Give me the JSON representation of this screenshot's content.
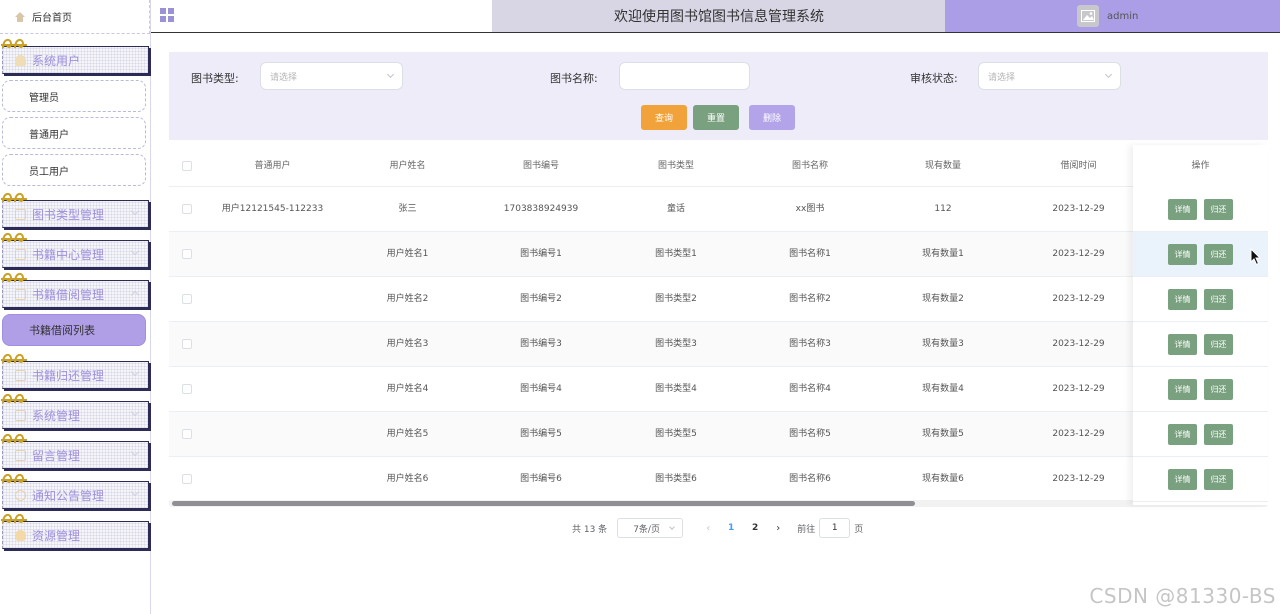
{
  "sidebar": {
    "home_label": "后台首页",
    "menus": [
      {
        "label": "系统用户",
        "icon": "user-icon"
      },
      {
        "label": "图书类型管理",
        "icon": "document-icon"
      },
      {
        "label": "书籍中心管理",
        "icon": "document-icon"
      },
      {
        "label": "书籍借阅管理",
        "icon": "document-icon"
      },
      {
        "label": "书籍归还管理",
        "icon": "document-icon"
      },
      {
        "label": "系统管理",
        "icon": "settings-icon"
      },
      {
        "label": "留言管理",
        "icon": "message-icon"
      },
      {
        "label": "通知公告管理",
        "icon": "info-icon"
      },
      {
        "label": "资源管理",
        "icon": "bulb-icon"
      }
    ],
    "user_subs": [
      "管理员",
      "普通用户",
      "员工用户"
    ],
    "borrow_sub_active": "书籍借阅列表"
  },
  "header": {
    "title": "欢迎使用图书馆图书信息管理系统",
    "username": "admin"
  },
  "search": {
    "type_label": "图书类型:",
    "type_placeholder": "请选择",
    "name_label": "图书名称:",
    "name_value": "",
    "status_label": "审核状态:",
    "status_placeholder": "请选择",
    "query_button": "查询",
    "reset_button": "重置",
    "delete_button": "删除"
  },
  "table": {
    "headers": [
      "普通用户",
      "用户姓名",
      "图书编号",
      "图书类型",
      "图书名称",
      "现有数量",
      "借阅时间"
    ],
    "ops_header": "操作",
    "detail_label": "详情",
    "return_label": "归还",
    "rows": [
      [
        "用户12121545-112233",
        "张三",
        "1703838924939",
        "童话",
        "xx图书",
        "112",
        "2023-12-29"
      ],
      [
        "",
        "用户姓名1",
        "图书编号1",
        "图书类型1",
        "图书名称1",
        "现有数量1",
        "2023-12-29"
      ],
      [
        "",
        "用户姓名2",
        "图书编号2",
        "图书类型2",
        "图书名称2",
        "现有数量2",
        "2023-12-29"
      ],
      [
        "",
        "用户姓名3",
        "图书编号3",
        "图书类型3",
        "图书名称3",
        "现有数量3",
        "2023-12-29"
      ],
      [
        "",
        "用户姓名4",
        "图书编号4",
        "图书类型4",
        "图书名称4",
        "现有数量4",
        "2023-12-29"
      ],
      [
        "",
        "用户姓名5",
        "图书编号5",
        "图书类型5",
        "图书名称5",
        "现有数量5",
        "2023-12-29"
      ],
      [
        "",
        "用户姓名6",
        "图书编号6",
        "图书类型6",
        "图书名称6",
        "现有数量6",
        "2023-12-29"
      ]
    ]
  },
  "pagination": {
    "total": "共 13 条",
    "page_size": "7条/页",
    "pages": [
      "1",
      "2"
    ],
    "current": "1",
    "goto_label": "前往",
    "goto_value": "1",
    "page_unit": "页"
  },
  "watermark": "CSDN @81330-BS",
  "colors": {
    "accent_purple": "#ab9ee6",
    "query_orange": "#f2a23a",
    "reset_green": "#7aa17f",
    "delete_purple": "#b3a4ea",
    "active_page_blue": "#409eff"
  }
}
